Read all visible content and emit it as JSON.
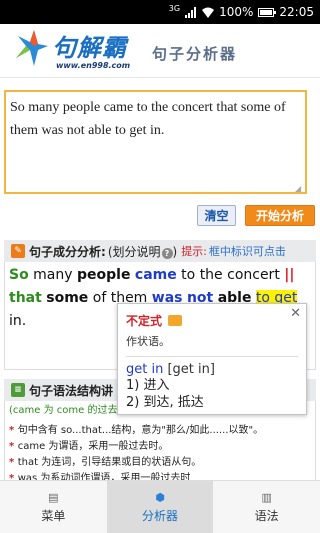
{
  "status_bar": {
    "network": "3G",
    "battery": "100%",
    "time": "22:05"
  },
  "header": {
    "logo_title": "句解霸",
    "logo_url": "www.en998.com",
    "subtitle": "句子分析器"
  },
  "input": {
    "value": "So many people came to the concert that some of them was not able to get in."
  },
  "buttons": {
    "clear": "清空",
    "start": "开始分析"
  },
  "analysis_section": {
    "title": "句子成分分析:",
    "link": "(划分说明",
    "link_close": ")",
    "tip_label": "提示:",
    "tip_text": "框中标识可点击",
    "tokens": [
      {
        "text": "So",
        "style": "green"
      },
      {
        "text": " many ",
        "style": "plain"
      },
      {
        "text": "people",
        "style": "black-b"
      },
      {
        "text": " ",
        "style": "plain"
      },
      {
        "text": "came",
        "style": "blue"
      },
      {
        "text": " to the concert ",
        "style": "plain"
      },
      {
        "text": "||",
        "style": "red"
      },
      {
        "text": " ",
        "style": "plain"
      },
      {
        "text": "that",
        "style": "green"
      },
      {
        "text": " ",
        "style": "plain"
      },
      {
        "text": "some",
        "style": "black-b"
      },
      {
        "text": " of them ",
        "style": "plain"
      },
      {
        "text": "was",
        "style": "blue"
      },
      {
        "text": " ",
        "style": "plain"
      },
      {
        "text": "not",
        "style": "blue"
      },
      {
        "text": " ",
        "style": "plain"
      },
      {
        "text": "able",
        "style": "black-b"
      },
      {
        "text": " ",
        "style": "plain"
      },
      {
        "text": "to get",
        "style": "hl"
      },
      {
        "text": " in.",
        "style": "plain"
      }
    ]
  },
  "grammar_section": {
    "title": "句子语法结构讲",
    "note": "(came 为 come 的过去",
    "items": [
      "句中含有 so...that...结构，意为\"那么/如此......以致\"。",
      "came 为谓语，采用一般过去时。",
      "that 为连词，引导结果或目的状语从句。",
      "was 为系动词作谓语，采用一般过去时"
    ]
  },
  "popup": {
    "type": "不定式",
    "function": "作状语。",
    "phrase": "get in",
    "pron": "[get in]",
    "definitions": [
      "1) 进入",
      "2) 到达, 抵达"
    ]
  },
  "bottom_nav": {
    "items": [
      {
        "label": "菜单"
      },
      {
        "label": "分析器"
      },
      {
        "label": "语法"
      }
    ],
    "active_index": 1
  }
}
